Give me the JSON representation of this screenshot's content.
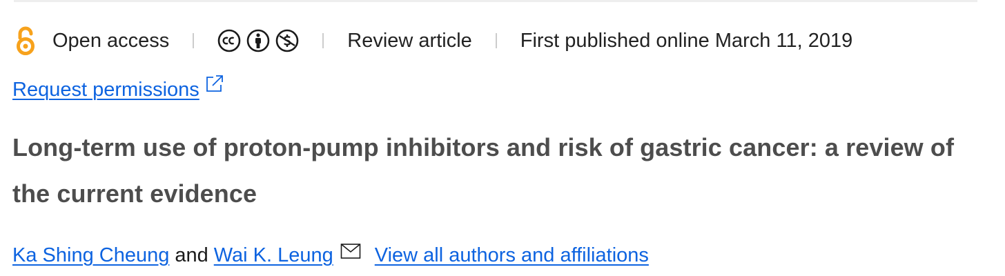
{
  "access": {
    "label": "Open access",
    "icon": "open-access-icon",
    "icon_color": "#f7a21c"
  },
  "license_icons": [
    "creative-commons-icon",
    "attribution-icon",
    "noncommercial-icon"
  ],
  "article_type": "Review article",
  "published": "First published online March 11, 2019",
  "permissions": {
    "label": "Request permissions",
    "icon": "external-link-icon"
  },
  "title": "Long-term use of proton-pump inhibitors and risk of gastric cancer: a review of the current evidence",
  "authors": {
    "list": [
      {
        "name": "Ka Shing Cheung"
      },
      {
        "name": "Wai K. Leung"
      }
    ],
    "conjunction": "and",
    "corresponding_icon": "mail-icon",
    "view_all_label": "View all authors and affiliations"
  },
  "colors": {
    "link": "#0d63e0",
    "title": "#4d4d4d",
    "separator": "#cccccc"
  }
}
